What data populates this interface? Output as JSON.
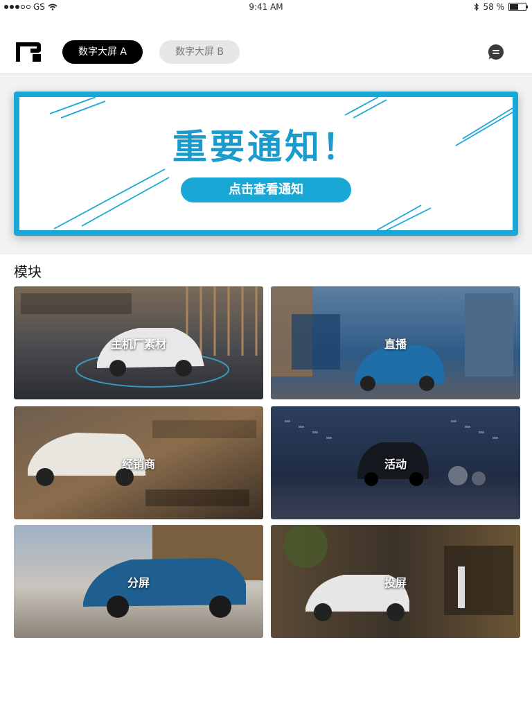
{
  "status_bar": {
    "carrier": "GS",
    "time": "9:41 AM",
    "battery": "58 %"
  },
  "header": {
    "tabs": [
      {
        "label": "数字大屏 A",
        "active": true
      },
      {
        "label": "数字大屏 B",
        "active": false
      }
    ]
  },
  "notice": {
    "title": "重要通知！",
    "button_label": "点击查看通知",
    "accent_color": "#19a8d6"
  },
  "modules": {
    "section_title": "模块",
    "items": [
      {
        "label": "主机厂素材"
      },
      {
        "label": "直播"
      },
      {
        "label": "经销商"
      },
      {
        "label": "活动"
      },
      {
        "label": "分屏"
      },
      {
        "label": "投屏"
      }
    ]
  }
}
